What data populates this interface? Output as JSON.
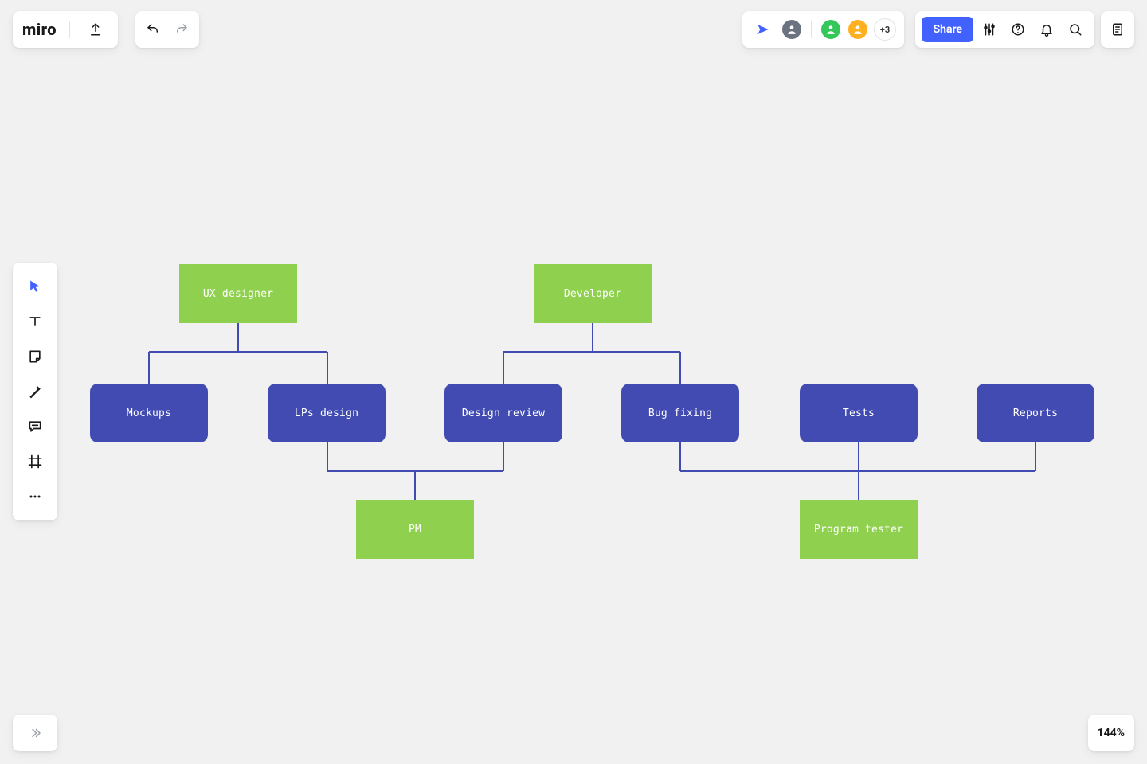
{
  "app": {
    "logo": "miro"
  },
  "share": {
    "label": "Share"
  },
  "collab": {
    "more": "+3"
  },
  "zoom": {
    "level": "144%"
  },
  "colors": {
    "accent": "#4262ff",
    "node_green": "#8fd14f",
    "node_blue": "#414bb2",
    "connector": "#414bb2"
  },
  "diagram": {
    "roles_top": [
      {
        "id": "ux",
        "label": "UX designer"
      },
      {
        "id": "dev",
        "label": "Developer"
      }
    ],
    "tasks": [
      {
        "id": "mockups",
        "label": "Mockups"
      },
      {
        "id": "lps_design",
        "label": "LPs design"
      },
      {
        "id": "design_review",
        "label": "Design review"
      },
      {
        "id": "bug_fixing",
        "label": "Bug fixing"
      },
      {
        "id": "tests",
        "label": "Tests"
      },
      {
        "id": "reports",
        "label": "Reports"
      }
    ],
    "roles_bottom": [
      {
        "id": "pm",
        "label": "PM"
      },
      {
        "id": "program_tester",
        "label": "Program tester"
      }
    ],
    "edges": [
      {
        "from": "ux",
        "to": "mockups"
      },
      {
        "from": "ux",
        "to": "lps_design"
      },
      {
        "from": "dev",
        "to": "design_review"
      },
      {
        "from": "dev",
        "to": "bug_fixing"
      },
      {
        "from": "lps_design",
        "to": "pm"
      },
      {
        "from": "design_review",
        "to": "pm"
      },
      {
        "from": "bug_fixing",
        "to": "program_tester"
      },
      {
        "from": "tests",
        "to": "program_tester"
      },
      {
        "from": "reports",
        "to": "program_tester"
      }
    ]
  }
}
